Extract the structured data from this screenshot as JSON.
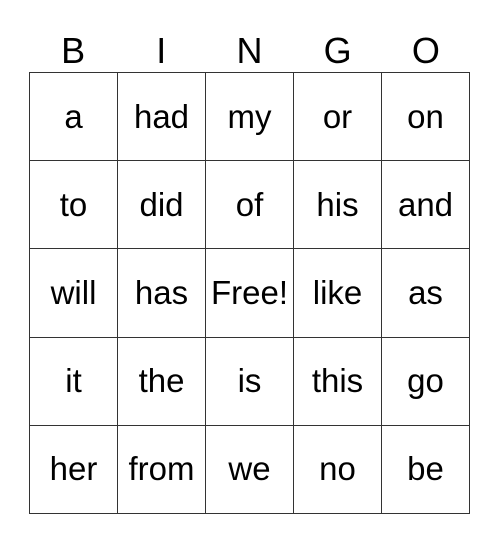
{
  "header": [
    "B",
    "I",
    "N",
    "G",
    "O"
  ],
  "cells": [
    [
      "a",
      "had",
      "my",
      "or",
      "on"
    ],
    [
      "to",
      "did",
      "of",
      "his",
      "and"
    ],
    [
      "will",
      "has",
      "Free!",
      "like",
      "as"
    ],
    [
      "it",
      "the",
      "is",
      "this",
      "go"
    ],
    [
      "her",
      "from",
      "we",
      "no",
      "be"
    ]
  ]
}
